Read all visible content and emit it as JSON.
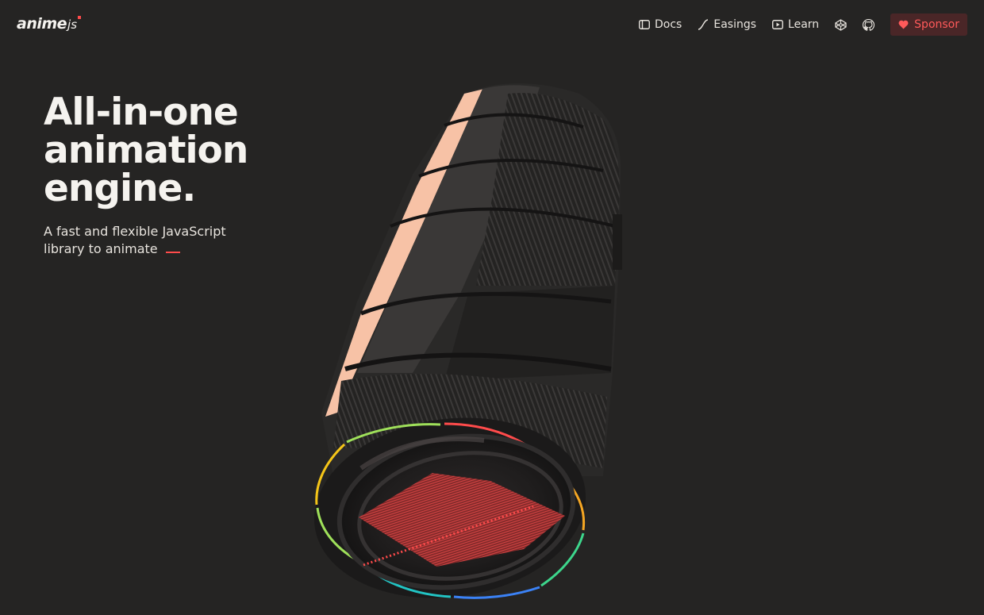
{
  "header": {
    "logo_text": "anime",
    "logo_suffix": "js",
    "nav": [
      {
        "label": "Docs",
        "icon": "docs-icon"
      },
      {
        "label": "Easings",
        "icon": "easing-curve-icon"
      },
      {
        "label": "Learn",
        "icon": "play-icon"
      }
    ],
    "codepen_icon": "codepen-icon",
    "github_icon": "github-icon",
    "sponsor_label": "Sponsor",
    "sponsor_icon": "heart-icon"
  },
  "hero": {
    "title_lines": [
      "All-in-one",
      "animation",
      "engine."
    ],
    "subtitle_lines": [
      "A fast and flexible JavaScript",
      "library to animate"
    ]
  },
  "colors": {
    "background": "#252423",
    "text": "#f5f3ef",
    "accent": "#ff4b4b",
    "sponsor_bg": "#4a2627",
    "lens_highlight": "#f7c2a6"
  }
}
